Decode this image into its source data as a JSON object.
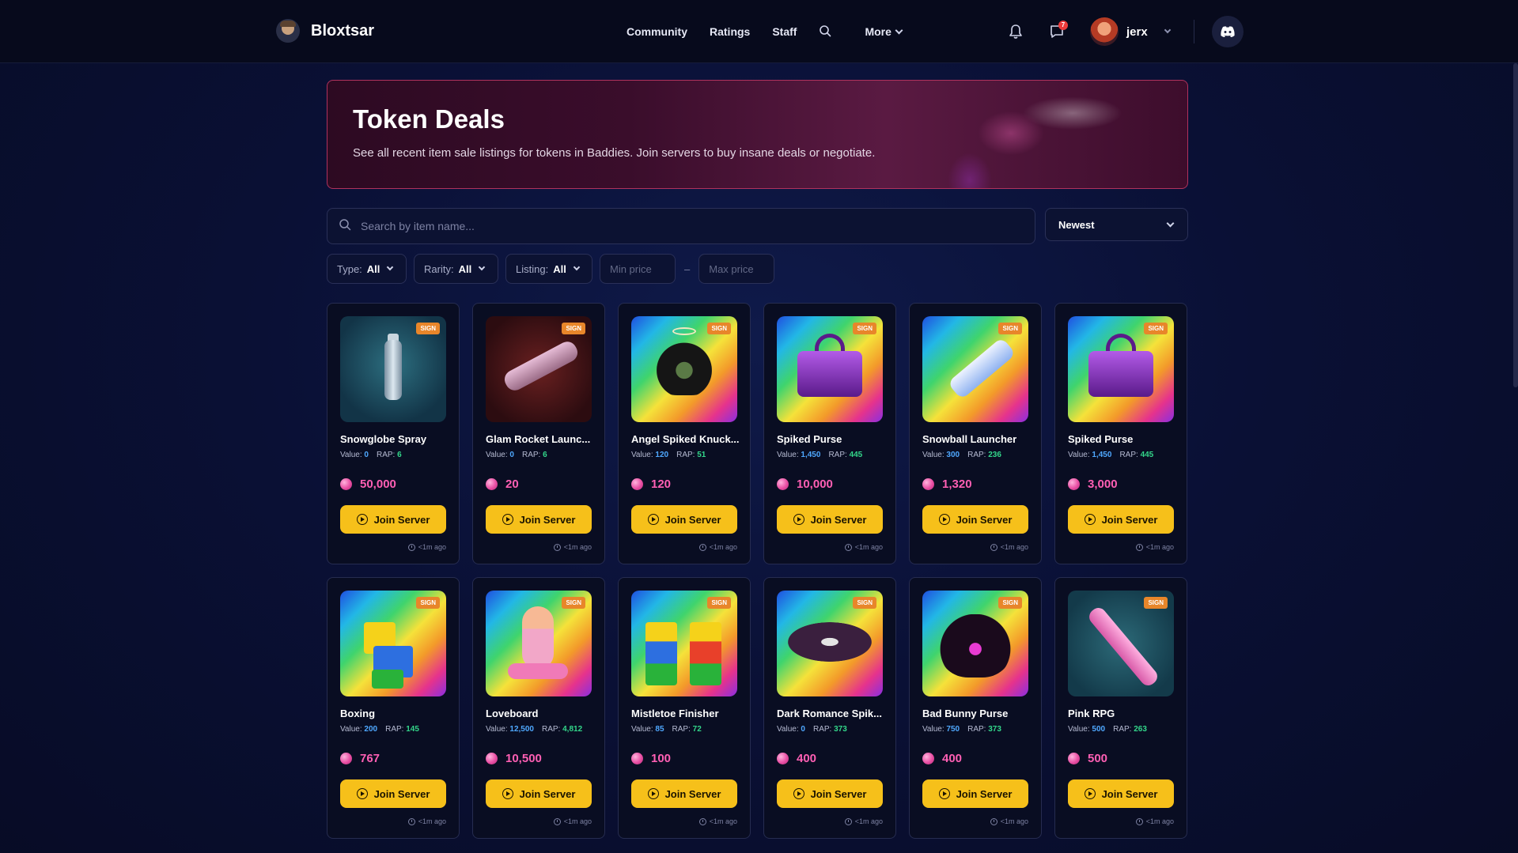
{
  "nav": {
    "brand": "Bloxtsar",
    "links": [
      "Community",
      "Ratings",
      "Staff"
    ],
    "more_label": "More",
    "messages_badge": "7",
    "username": "jerx"
  },
  "hero": {
    "title": "Token Deals",
    "description": "See all recent item sale listings for tokens in Baddies. Join servers to buy insane deals or negotiate."
  },
  "search": {
    "placeholder": "Search by item name..."
  },
  "sort": {
    "selected": "Newest"
  },
  "filters": {
    "type_label": "Type:",
    "type_value": "All",
    "rarity_label": "Rarity:",
    "rarity_value": "All",
    "listing_label": "Listing:",
    "listing_value": "All",
    "min_placeholder": "Min price",
    "max_placeholder": "Max price",
    "separator": "–"
  },
  "card_common": {
    "badge": "SIGN",
    "value_label": "Value:",
    "rap_label": "RAP:",
    "join_label": "Join Server",
    "time": "<1m ago"
  },
  "listings": [
    {
      "name": "Snowglobe Spray",
      "value": "0",
      "rap": "6",
      "price": "50,000",
      "art": "teal"
    },
    {
      "name": "Glam Rocket Launc...",
      "value": "0",
      "rap": "6",
      "price": "20",
      "art": "red"
    },
    {
      "name": "Angel Spiked Knuck...",
      "value": "120",
      "rap": "51",
      "price": "120",
      "art": "rainbow"
    },
    {
      "name": "Spiked Purse",
      "value": "1,450",
      "rap": "445",
      "price": "10,000",
      "art": "rainbow"
    },
    {
      "name": "Snowball Launcher",
      "value": "300",
      "rap": "236",
      "price": "1,320",
      "art": "rainbow"
    },
    {
      "name": "Spiked Purse",
      "value": "1,450",
      "rap": "445",
      "price": "3,000",
      "art": "rainbow"
    },
    {
      "name": "Boxing",
      "value": "200",
      "rap": "145",
      "price": "767",
      "art": "rainbow"
    },
    {
      "name": "Loveboard",
      "value": "12,500",
      "rap": "4,812",
      "price": "10,500",
      "art": "rainbow"
    },
    {
      "name": "Mistletoe Finisher",
      "value": "85",
      "rap": "72",
      "price": "100",
      "art": "rainbow"
    },
    {
      "name": "Dark Romance Spik...",
      "value": "0",
      "rap": "373",
      "price": "400",
      "art": "rainbow"
    },
    {
      "name": "Bad Bunny Purse",
      "value": "750",
      "rap": "373",
      "price": "400",
      "art": "rainbow"
    },
    {
      "name": "Pink RPG",
      "value": "500",
      "rap": "263",
      "price": "500",
      "art": "teal"
    }
  ],
  "colors": {
    "accent_yellow": "#f6c01a",
    "token_pink": "#ff5fb4",
    "value_blue": "#4fa8ff",
    "rap_green": "#33d68a",
    "badge_orange": "#e8862a"
  }
}
